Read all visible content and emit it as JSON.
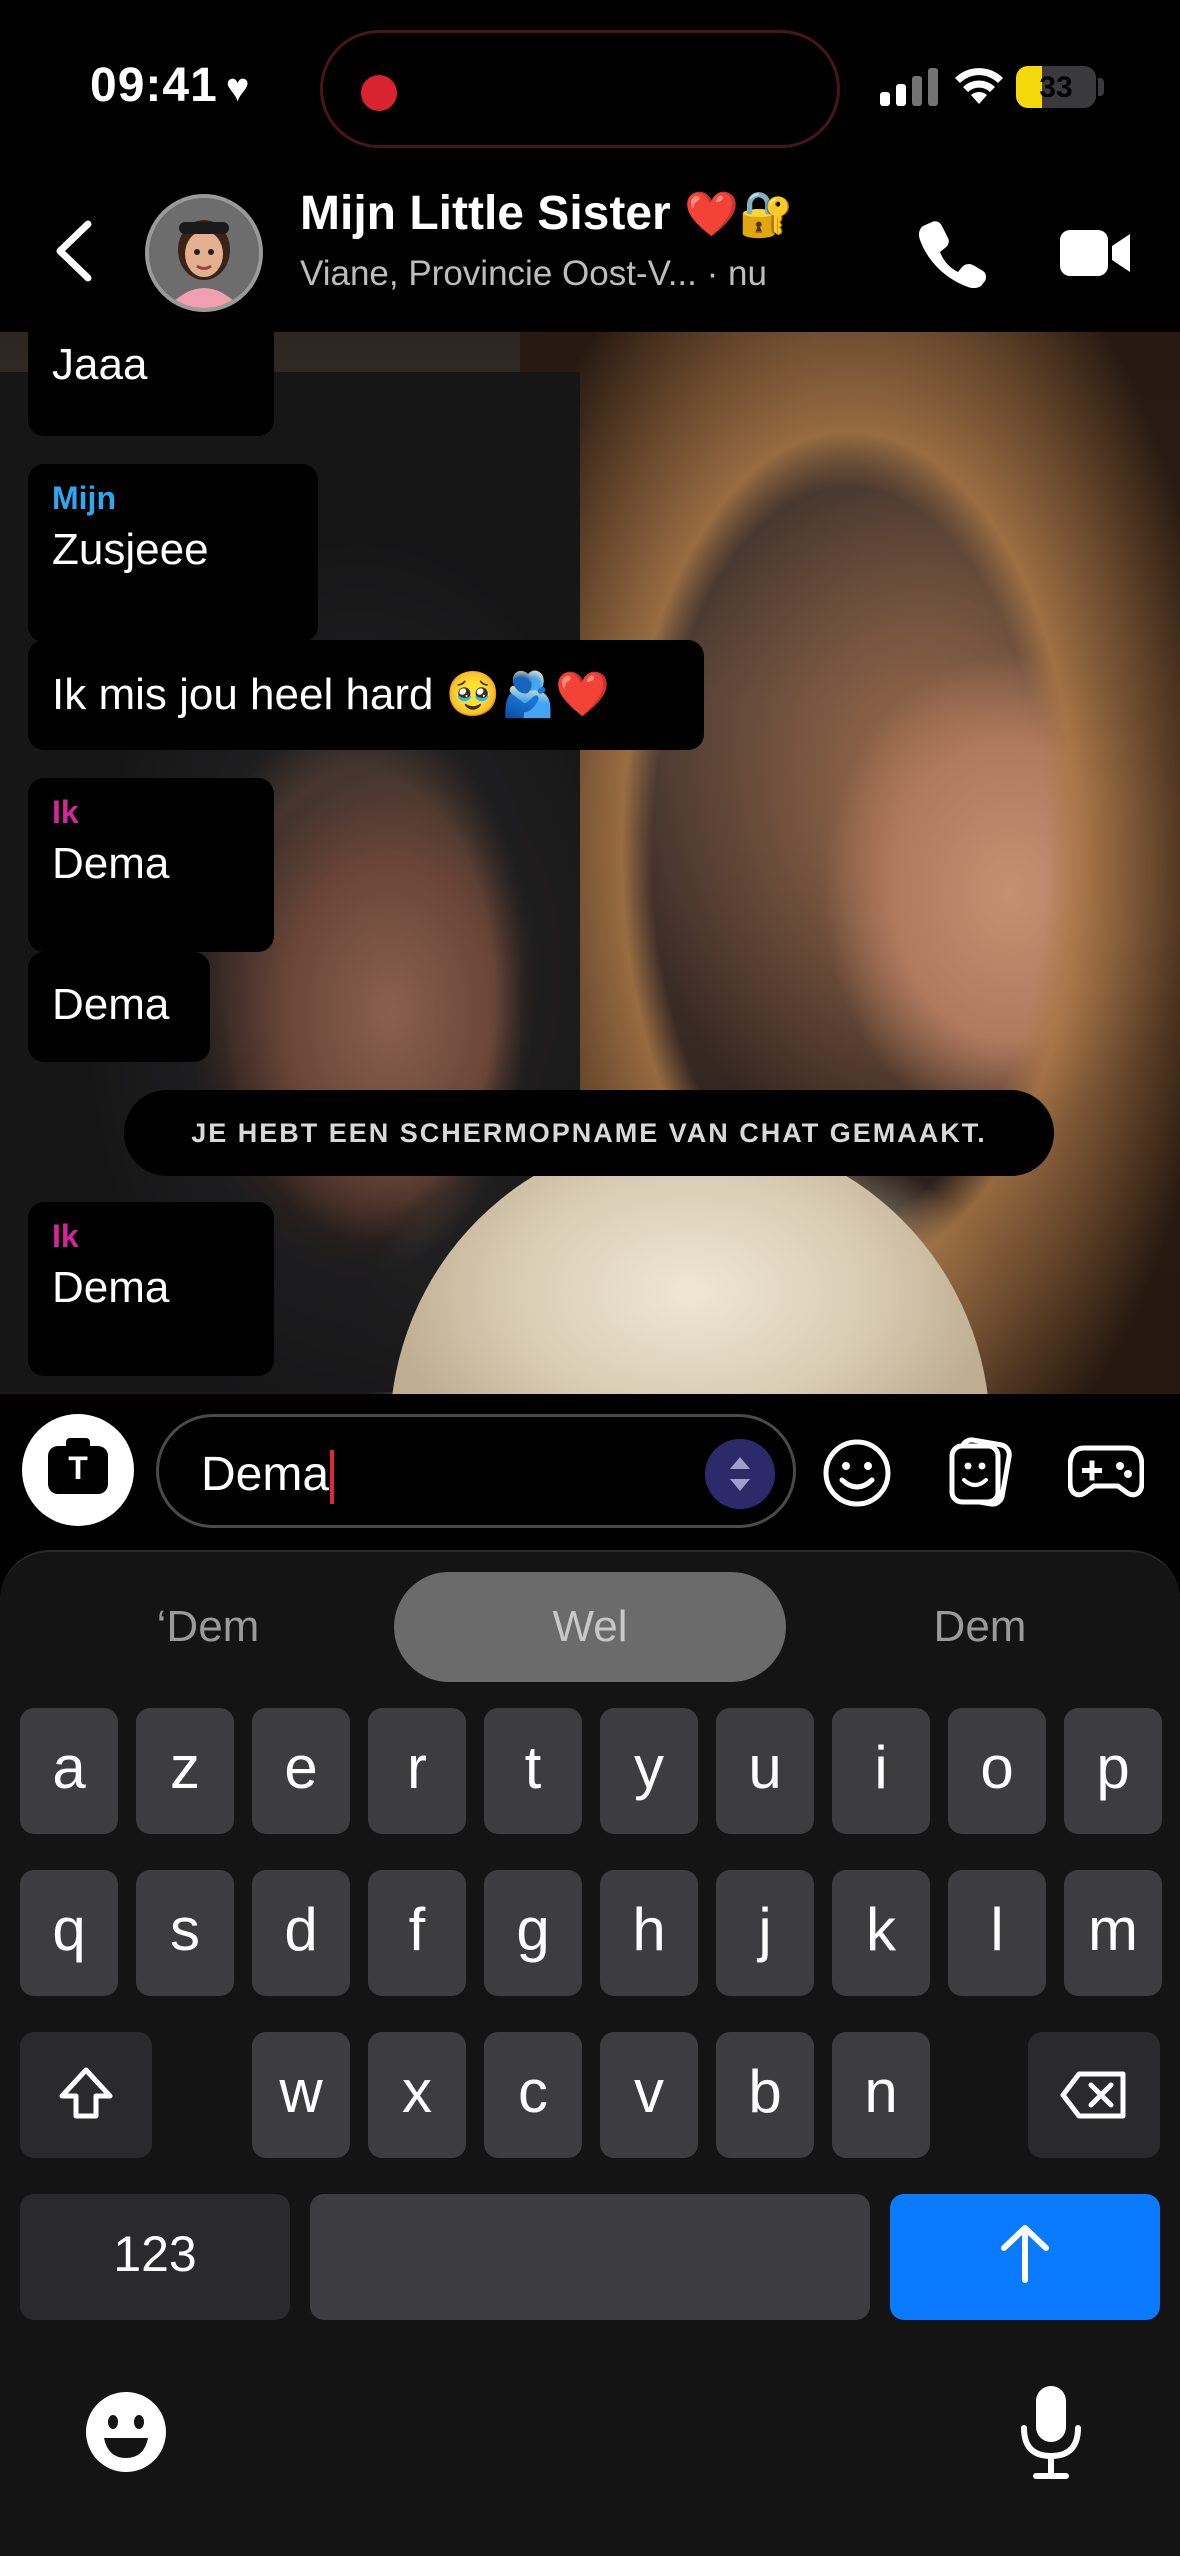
{
  "status_bar": {
    "time": "09:41",
    "battery": "33",
    "battery_level": 0.33
  },
  "header": {
    "title": "Mijn Little Sister",
    "title_emoji": "❤️🔐",
    "location": "Viane, Provincie Oost-V...",
    "last_active": "· nu"
  },
  "messages": [
    {
      "sender": "",
      "text": "Jaaa"
    },
    {
      "sender": "Mijn",
      "text": "Zusjeee"
    },
    {
      "sender": "",
      "text": "Ik mis jou heel hard 🥹🫂❤️"
    },
    {
      "sender": "Ik",
      "text": "Dema"
    },
    {
      "sender": "",
      "text": "Dema"
    },
    {
      "sender": "Ik",
      "text": "Dema"
    }
  ],
  "notice": "JE HEBT EEN SCHERMOPNAME VAN CHAT GEMAAKT.",
  "composer": {
    "value": "Dema",
    "camera_glyph": "T"
  },
  "keyboard": {
    "suggestions": [
      "‘Dem",
      "Wel",
      "Dem"
    ],
    "row1": [
      "a",
      "z",
      "e",
      "r",
      "t",
      "y",
      "u",
      "i",
      "o",
      "p"
    ],
    "row2": [
      "q",
      "s",
      "d",
      "f",
      "g",
      "h",
      "j",
      "k",
      "l",
      "m"
    ],
    "row3": [
      "w",
      "x",
      "c",
      "v",
      "b",
      "n"
    ],
    "numbers_key": "123"
  },
  "colors": {
    "friend_name": "#2ea7f2",
    "my_name": "#d4269a",
    "send": "#0a7afe",
    "record": "#d9232e"
  }
}
